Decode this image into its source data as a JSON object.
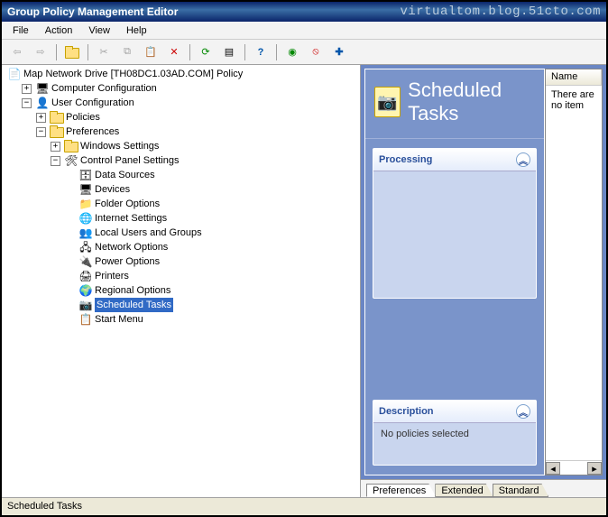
{
  "title": "Group Policy Management Editor",
  "watermark": "virtualtom.blog.51cto.com",
  "menu": [
    "File",
    "Action",
    "View",
    "Help"
  ],
  "toolbar_icons": [
    {
      "name": "back-icon",
      "glyph": "←",
      "disabled": true
    },
    {
      "name": "forward-icon",
      "glyph": "→",
      "disabled": true
    },
    {
      "name": "up-icon",
      "glyph": "folder",
      "disabled": false
    },
    {
      "name": "cut-icon",
      "glyph": "✂",
      "disabled": true
    },
    {
      "name": "copy-icon",
      "glyph": "⧉",
      "disabled": true
    },
    {
      "name": "paste-icon",
      "glyph": "📋",
      "disabled": false
    },
    {
      "name": "delete-icon",
      "glyph": "✕",
      "disabled": false
    },
    {
      "name": "refresh-icon",
      "glyph": "⟳",
      "disabled": false
    },
    {
      "name": "props-icon",
      "glyph": "🗔",
      "disabled": false
    },
    {
      "name": "help-icon",
      "glyph": "?",
      "disabled": false
    },
    {
      "name": "options-icon",
      "glyph": "⚙",
      "disabled": false
    },
    {
      "name": "stop-icon",
      "glyph": "⦸",
      "disabled": false
    },
    {
      "name": "add-icon",
      "glyph": "✚",
      "disabled": false
    }
  ],
  "tree": {
    "root": "Map Network Drive [TH08DC1.03AD.COM] Policy",
    "computer_config": "Computer Configuration",
    "user_config": "User Configuration",
    "policies": "Policies",
    "preferences": "Preferences",
    "windows_settings": "Windows Settings",
    "control_panel_settings": "Control Panel Settings",
    "cp_items": [
      {
        "label": "Data Sources",
        "emoji": "🗄"
      },
      {
        "label": "Devices",
        "emoji": "🖥"
      },
      {
        "label": "Folder Options",
        "emoji": "📁"
      },
      {
        "label": "Internet Settings",
        "emoji": "🌐"
      },
      {
        "label": "Local Users and Groups",
        "emoji": "👥"
      },
      {
        "label": "Network Options",
        "emoji": "🖧"
      },
      {
        "label": "Power Options",
        "emoji": "🔌"
      },
      {
        "label": "Printers",
        "emoji": "🖨"
      },
      {
        "label": "Regional Options",
        "emoji": "🌍"
      },
      {
        "label": "Scheduled Tasks",
        "emoji": "📷",
        "selected": true
      },
      {
        "label": "Start Menu",
        "emoji": "📋"
      }
    ]
  },
  "right": {
    "header_title": "Scheduled Tasks",
    "processing_title": "Processing",
    "description_title": "Description",
    "description_body": "No policies selected",
    "list_columns": [
      "Name"
    ],
    "list_empty": "There are no item"
  },
  "tabs": [
    "Preferences",
    "Extended",
    "Standard"
  ],
  "statusbar": "Scheduled Tasks"
}
